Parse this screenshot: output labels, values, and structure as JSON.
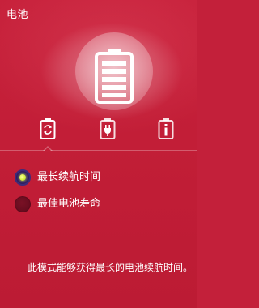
{
  "panel": {
    "title": "电池"
  },
  "hero": {
    "icon": "battery-full-icon"
  },
  "modes": [
    {
      "icon": "battery-recycle-icon",
      "selected": true
    },
    {
      "icon": "battery-plug-icon",
      "selected": false
    },
    {
      "icon": "battery-info-icon",
      "selected": false
    }
  ],
  "options": [
    {
      "label": "最长续航时间",
      "checked": true
    },
    {
      "label": "最佳电池寿命",
      "checked": false
    }
  ],
  "description": "此模式能够获得最长的电池续航时间。",
  "colors": {
    "background": "#c3203a",
    "radio_checked": "#2a1760",
    "radio_dot": "#d9f04a",
    "radio_unchecked": "#6a0d20"
  }
}
